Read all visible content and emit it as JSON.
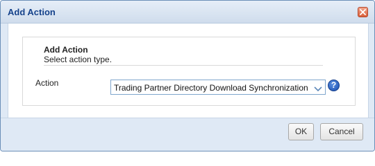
{
  "dialog": {
    "title": "Add Action",
    "close_icon": "close-icon"
  },
  "panel": {
    "title": "Add Action",
    "subtitle": "Select action type."
  },
  "form": {
    "action_label": "Action",
    "action_selected": "Trading Partner Directory Download Synchronization",
    "dropdown_icon": "chevron-down-icon",
    "help_icon": "help-icon",
    "help_glyph": "?"
  },
  "footer": {
    "ok_label": "OK",
    "cancel_label": "Cancel"
  },
  "colors": {
    "title_text": "#15428b",
    "frame_bg": "#dfe9f5",
    "select_border": "#7fa6cd",
    "help_icon": "#1b4fb0",
    "close_button": "#d9603a"
  }
}
